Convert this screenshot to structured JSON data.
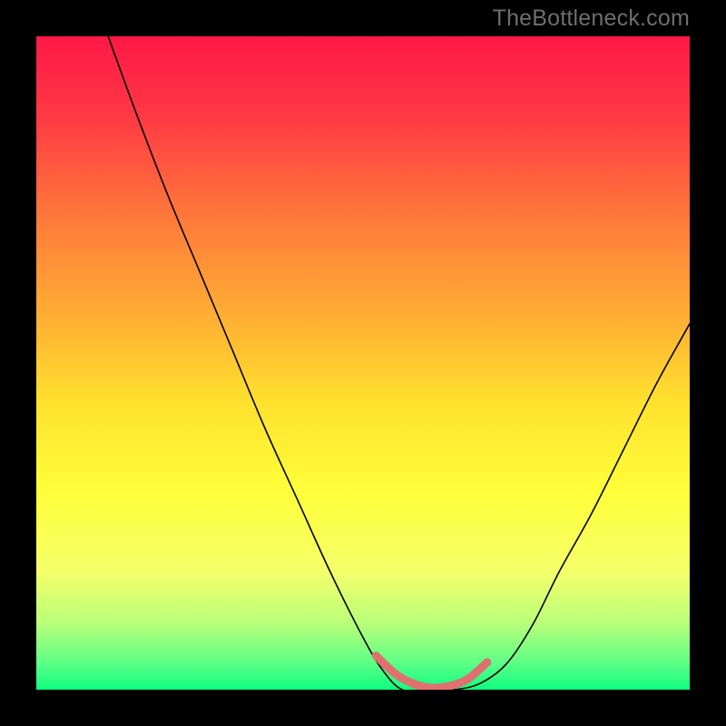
{
  "watermark": {
    "text": "TheBottleneck.com"
  },
  "chart_data": {
    "type": "line",
    "title": "",
    "xlabel": "",
    "ylabel": "",
    "xlim": [
      0,
      100
    ],
    "ylim": [
      0,
      100
    ],
    "grid": false,
    "legend": "none",
    "gradient_stops": [
      {
        "pct": 0,
        "color": "#ff1846"
      },
      {
        "pct": 12,
        "color": "#ff3844"
      },
      {
        "pct": 28,
        "color": "#ff7a3a"
      },
      {
        "pct": 44,
        "color": "#ffb233"
      },
      {
        "pct": 56,
        "color": "#ffe12e"
      },
      {
        "pct": 70,
        "color": "#ffff3a"
      },
      {
        "pct": 82,
        "color": "#f4ff6a"
      },
      {
        "pct": 90,
        "color": "#b7ff7a"
      },
      {
        "pct": 96,
        "color": "#5cff86"
      },
      {
        "pct": 100,
        "color": "#0eff80"
      }
    ],
    "series": [
      {
        "name": "bottleneck-curve",
        "color": "#000000",
        "stroke_width": 1.6,
        "x": [
          11,
          15,
          20,
          25,
          30,
          35,
          40,
          45,
          50,
          53,
          56,
          60,
          64,
          68,
          72,
          76,
          80,
          85,
          90,
          95,
          100
        ],
        "values": [
          100,
          89,
          76,
          64,
          52,
          40,
          29,
          18,
          8,
          3,
          0,
          0,
          0,
          1,
          4,
          10,
          18,
          27,
          37,
          47,
          56
        ]
      },
      {
        "name": "optimal-range-marker",
        "color": "#e07070",
        "stroke_width": 9,
        "x": [
          52,
          55,
          58,
          60.5,
          63,
          66,
          69
        ],
        "values": [
          5.2,
          2.4,
          0.8,
          0.3,
          0.5,
          1.6,
          4.2
        ]
      }
    ],
    "annotations": []
  }
}
